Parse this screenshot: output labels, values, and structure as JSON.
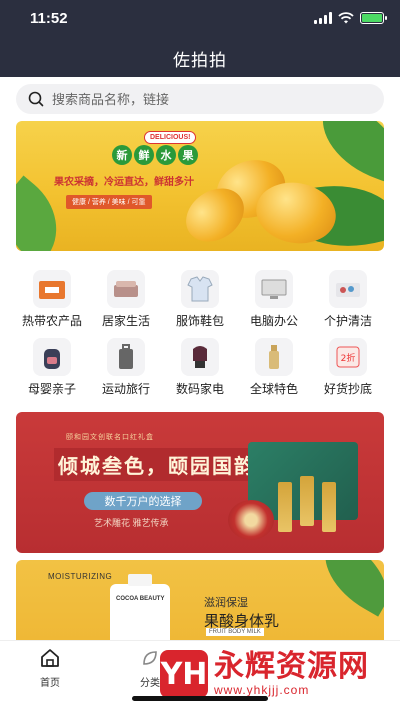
{
  "status_bar": {
    "time": "11:52"
  },
  "header": {
    "title": "佐拍拍"
  },
  "search": {
    "placeholder": "搜索商品名称，链接"
  },
  "banner_fruit": {
    "tag_chars": [
      "新",
      "鲜",
      "水",
      "果"
    ],
    "badge": "DELICIOUS!",
    "line1": "果农采摘，冷运直达，鲜甜多汁",
    "line2": "健康 / 营养 / 美味 / 可靠"
  },
  "categories": [
    {
      "label": "热带农产品",
      "icon": "crate-icon"
    },
    {
      "label": "居家生活",
      "icon": "bedding-icon"
    },
    {
      "label": "服饰鞋包",
      "icon": "shirt-icon"
    },
    {
      "label": "电脑办公",
      "icon": "computer-icon"
    },
    {
      "label": "个护清洁",
      "icon": "cleaning-icon"
    },
    {
      "label": "母婴亲子",
      "icon": "backpack-icon"
    },
    {
      "label": "运动旅行",
      "icon": "suitcase-icon"
    },
    {
      "label": "数码家电",
      "icon": "appliance-icon"
    },
    {
      "label": "全球特色",
      "icon": "bottle-icon"
    },
    {
      "label": "好货抄底",
      "icon": "sale-tag-icon"
    }
  ],
  "promo_lipstick": {
    "top_text": "颐和园文创联名口红礼盒",
    "title": "倾城叁色，颐园国韵",
    "button": "数千万户的选择",
    "subtitle": "艺术雕花    雅艺传承"
  },
  "promo_lotion": {
    "en_label": "MOISTURIZING",
    "brand": "COCOA BEAUTY",
    "subtitle": "滋润保湿",
    "title": "果酸身体乳",
    "en_sub": "FRUIT BODY MILK"
  },
  "tabbar": {
    "tabs": [
      {
        "label": "首页",
        "icon": "home-icon"
      },
      {
        "label": "分类",
        "icon": "category-icon"
      }
    ]
  },
  "watermark": {
    "logo": "YH",
    "text": "永辉资源网",
    "url": "www.yhkjjj.com"
  },
  "colors": {
    "header_bg": "#2b2f3f",
    "banner_yellow": "#f3c230",
    "promo_red": "#c93a3a",
    "watermark_red": "#d9252d"
  }
}
